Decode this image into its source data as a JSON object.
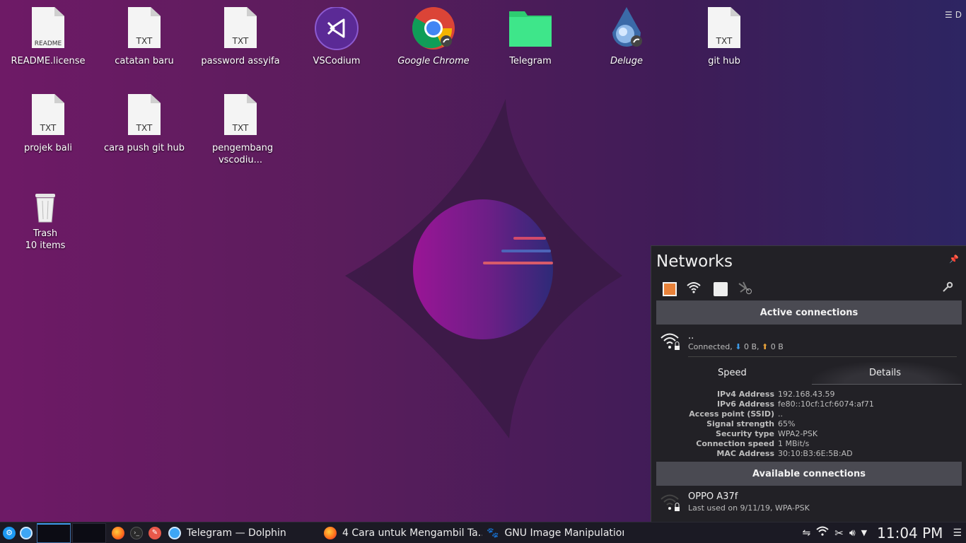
{
  "desktop": {
    "icons": [
      {
        "label": "README.license",
        "tag": "README",
        "kind": "file"
      },
      {
        "label": "catatan baru",
        "tag": "TXT",
        "kind": "file"
      },
      {
        "label": "password assyifa",
        "tag": "TXT",
        "kind": "file"
      },
      {
        "label": "VSCodium",
        "kind": "app"
      },
      {
        "label": "Google Chrome",
        "kind": "app"
      },
      {
        "label": "Telegram",
        "kind": "folder"
      },
      {
        "label": "Deluge",
        "kind": "app"
      },
      {
        "label": "git hub",
        "tag": "TXT",
        "kind": "file"
      },
      {
        "label": "projek bali",
        "tag": "TXT",
        "kind": "file"
      },
      {
        "label": "cara push git hub",
        "tag": "TXT",
        "kind": "file"
      },
      {
        "label": "pengembang vscodiu...",
        "tag": "TXT",
        "kind": "file"
      },
      {
        "label": "Trash",
        "sublabel": "10 items",
        "kind": "trash"
      }
    ],
    "corner_menu_label": "D"
  },
  "networks": {
    "title": "Networks",
    "active_header": "Active connections",
    "active": {
      "name": "..",
      "status": "Connected,",
      "down": "0 B,",
      "up": "0 B"
    },
    "tabs": {
      "speed": "Speed",
      "details": "Details"
    },
    "details": [
      {
        "k": "IPv4 Address",
        "v": "192.168.43.59"
      },
      {
        "k": "IPv6 Address",
        "v": "fe80::10cf:1cf:6074:af71"
      },
      {
        "k": "Access point (SSID)",
        "v": ".."
      },
      {
        "k": "Signal strength",
        "v": "65%"
      },
      {
        "k": "Security type",
        "v": "WPA2-PSK"
      },
      {
        "k": "Connection speed",
        "v": "1 MBit/s"
      },
      {
        "k": "MAC Address",
        "v": "30:10:B3:6E:5B:AD"
      }
    ],
    "available_header": "Available connections",
    "available": [
      {
        "name": "OPPO A37f",
        "sub": "Last used on 9/11/19, WPA-PSK"
      }
    ]
  },
  "panel": {
    "tasks": [
      {
        "label": "Telegram — Dolphin"
      },
      {
        "label": "4 Cara untuk Mengambil Ta..."
      },
      {
        "label": "GNU Image Manipulation Pr..."
      }
    ],
    "clock": "11:04 PM"
  },
  "colors": {
    "accent_orange": "#e8823a",
    "panel_bg": "#1b1a24",
    "popup_bg": "#222126"
  }
}
